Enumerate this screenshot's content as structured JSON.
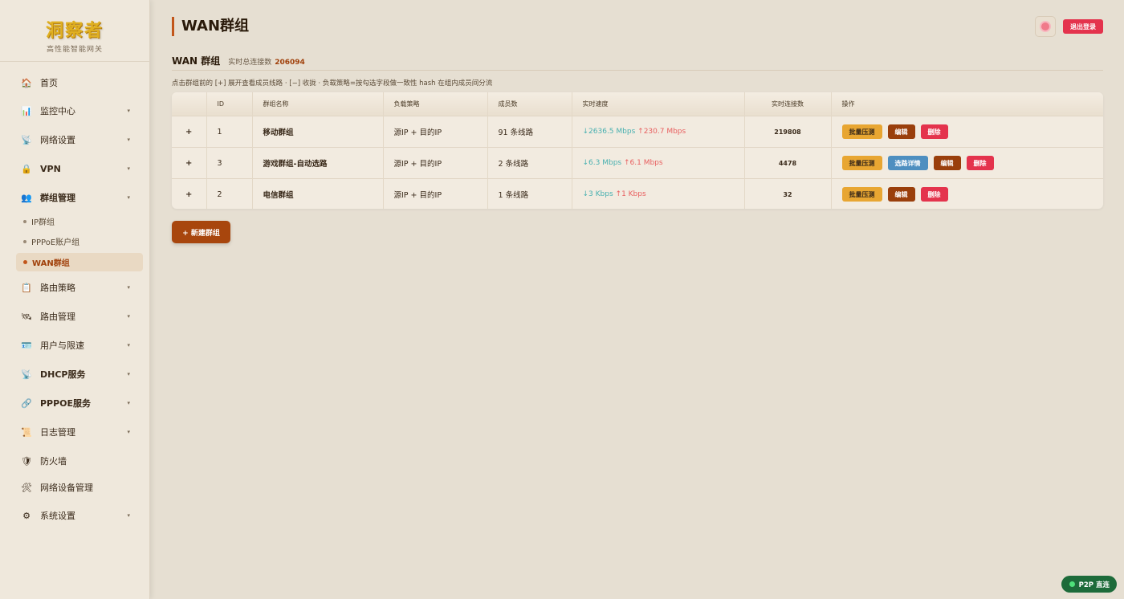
{
  "brand": {
    "logo": "洞察者",
    "subtitle": "高性能智能网关"
  },
  "sidebar": {
    "items": [
      {
        "label": "首页",
        "icon": "home-icon",
        "glyph": "🏠",
        "chevron": false,
        "bold": false
      },
      {
        "label": "监控中心",
        "icon": "chart-icon",
        "glyph": "📊",
        "chevron": true,
        "bold": false
      },
      {
        "label": "网络设置",
        "icon": "satellite-icon",
        "glyph": "📡",
        "chevron": true,
        "bold": false
      },
      {
        "label": "VPN",
        "icon": "lock-icon",
        "glyph": "🔒",
        "chevron": true,
        "bold": true
      },
      {
        "label": "群组管理",
        "icon": "users-icon",
        "glyph": "👥",
        "chevron": true,
        "bold": true
      },
      {
        "label": "路由策略",
        "icon": "clipboard-icon",
        "glyph": "📋",
        "chevron": true,
        "bold": false
      },
      {
        "label": "路由管理",
        "icon": "route-icon",
        "glyph": "🛰",
        "chevron": true,
        "bold": false
      },
      {
        "label": "用户与限速",
        "icon": "id-card-icon",
        "glyph": "🪪",
        "chevron": true,
        "bold": false
      },
      {
        "label": "DHCP服务",
        "icon": "dhcp-icon",
        "glyph": "📡",
        "chevron": true,
        "bold": true
      },
      {
        "label": "PPPOE服务",
        "icon": "link-icon",
        "glyph": "🔗",
        "chevron": true,
        "bold": true
      },
      {
        "label": "日志管理",
        "icon": "scroll-icon",
        "glyph": "📜",
        "chevron": true,
        "bold": false
      },
      {
        "label": "防火墙",
        "icon": "shield-icon",
        "glyph": "🛡",
        "chevron": false,
        "bold": false
      },
      {
        "label": "网络设备管理",
        "icon": "tools-icon",
        "glyph": "🛠",
        "chevron": false,
        "bold": false
      },
      {
        "label": "系统设置",
        "icon": "gear-icon",
        "glyph": "⚙",
        "chevron": true,
        "bold": false
      }
    ],
    "subitems": [
      {
        "label": "IP群组",
        "active": false
      },
      {
        "label": "PPPoE账户组",
        "active": false
      },
      {
        "label": "WAN群组",
        "active": true
      }
    ]
  },
  "header": {
    "title": "WAN群组",
    "logout_label": "退出登录"
  },
  "section": {
    "title": "WAN 群组",
    "live_label": "实时总连接数",
    "live_value": "206094",
    "hint": "点击群组前的 [+] 展开查看成员线路 · [−] 收拢 · 负载策略=按勾选字段做一致性 hash 在组内成员间分流"
  },
  "table": {
    "columns": [
      "",
      "ID",
      "群组名称",
      "负载策略",
      "成员数",
      "实时速度",
      "实时连接数",
      "操作"
    ],
    "rows": [
      {
        "expand": "+",
        "id": "1",
        "name": "移动群组",
        "policy": "源IP + 目的IP",
        "members": "91 条线路",
        "down": "↓2636.5 Mbps",
        "up": "↑230.7 Mbps",
        "conns": "219808",
        "has_detail": false
      },
      {
        "expand": "+",
        "id": "3",
        "name": "游戏群组-自动选路",
        "policy": "源IP + 目的IP",
        "members": "2 条线路",
        "down": "↓6.3 Mbps",
        "up": "↑6.1 Mbps",
        "conns": "4478",
        "has_detail": true
      },
      {
        "expand": "+",
        "id": "2",
        "name": "电信群组",
        "policy": "源IP + 目的IP",
        "members": "1 条线路",
        "down": "↓3 Kbps",
        "up": "↑1 Kbps",
        "conns": "32",
        "has_detail": false
      }
    ],
    "actions": {
      "stress": "批量压测",
      "detail": "选路详情",
      "edit": "编辑",
      "delete": "删除"
    }
  },
  "new_group_label": "+ 新建群组",
  "p2p_label": "P2P 直连",
  "colors": {
    "accent": "#c2561a",
    "danger": "#e4334d",
    "warn": "#e8a632",
    "info": "#4e8fc0",
    "brown": "#9a3f0c",
    "down": "#48b0b0",
    "up": "#e86060",
    "p2p": "#1d6b3a"
  }
}
